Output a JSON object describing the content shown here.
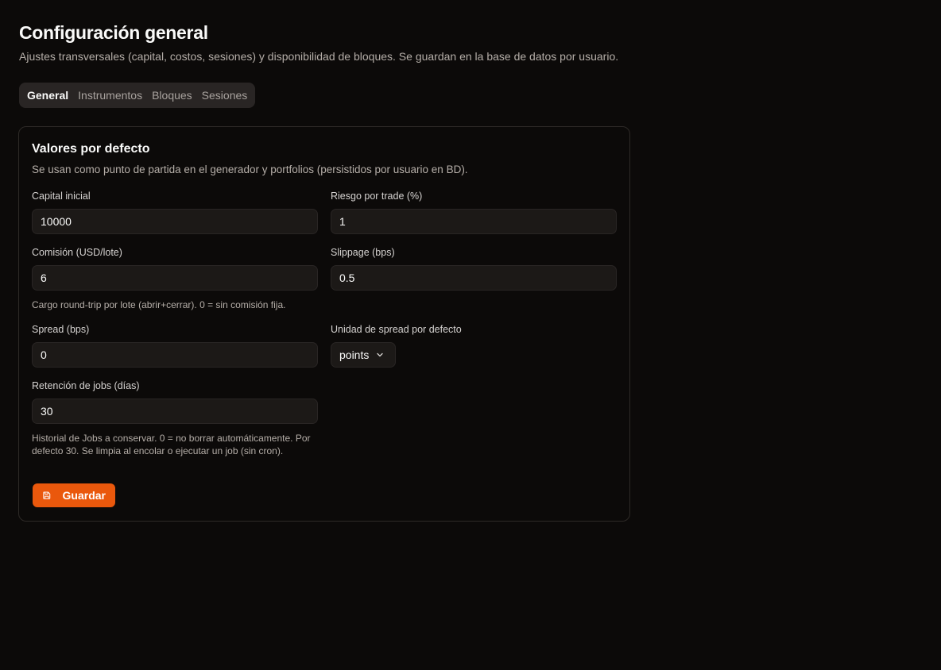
{
  "page": {
    "title": "Configuración general",
    "subtitle": "Ajustes transversales (capital, costos, sesiones) y disponibilidad de bloques. Se guardan en la base de datos por usuario."
  },
  "tabs": [
    {
      "label": "General",
      "active": true
    },
    {
      "label": "Instrumentos",
      "active": false
    },
    {
      "label": "Bloques",
      "active": false
    },
    {
      "label": "Sesiones",
      "active": false
    }
  ],
  "card": {
    "title": "Valores por defecto",
    "description": "Se usan como punto de partida en el generador y portfolios (persistidos por usuario en BD)."
  },
  "fields": {
    "capital": {
      "label": "Capital inicial",
      "value": "10000"
    },
    "risk": {
      "label": "Riesgo por trade (%)",
      "value": "1"
    },
    "commission": {
      "label": "Comisión (USD/lote)",
      "value": "6",
      "hint": "Cargo round-trip por lote (abrir+cerrar). 0 = sin comisión fija."
    },
    "slippage": {
      "label": "Slippage (bps)",
      "value": "0.5"
    },
    "spread": {
      "label": "Spread (bps)",
      "value": "0"
    },
    "spread_unit": {
      "label": "Unidad de spread por defecto",
      "value": "points"
    },
    "retention": {
      "label": "Retención de jobs (días)",
      "value": "30",
      "hint_line1": "Historial de Jobs a conservar. 0 = no borrar automáticamente. Por",
      "hint_line2": "defecto 30. Se limpia al encolar o ejecutar un job (sin cron)."
    }
  },
  "actions": {
    "save_label": "Guardar"
  },
  "colors": {
    "accent": "#ea580c",
    "background": "#0c0a09",
    "input_bg": "#1c1917"
  }
}
